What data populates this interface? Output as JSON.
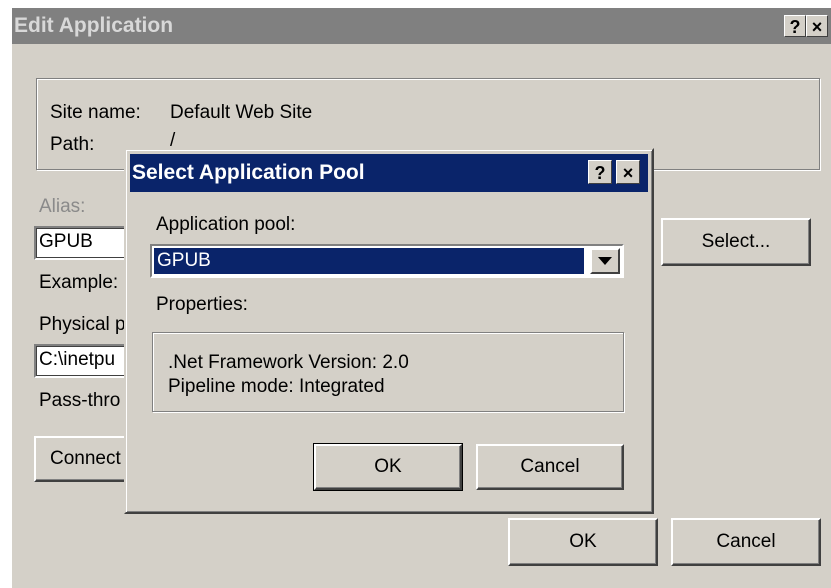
{
  "edit_app": {
    "title": "Edit Application",
    "help_icon": "?",
    "close_icon": "×",
    "site_name_label": "Site name:",
    "site_name_value": "Default Web Site",
    "path_label": "Path:",
    "path_value": "/",
    "alias_label": "Alias:",
    "alias_value": "GPUB",
    "example_label": "Example:",
    "physical_label": "Physical p",
    "physical_value": "C:\\inetpu",
    "passthrough_label": "Pass-thro",
    "connect_label": "Connect",
    "select_label": "Select...",
    "ok_label": "OK",
    "cancel_label": "Cancel"
  },
  "select_pool": {
    "title": "Select Application Pool",
    "help_icon": "?",
    "close_icon": "×",
    "pool_label": "Application pool:",
    "pool_value": "GPUB",
    "properties_label": "Properties:",
    "framework_line": ".Net Framework Version: 2.0",
    "pipeline_line": "Pipeline mode: Integrated",
    "ok_label": "OK",
    "cancel_label": "Cancel"
  },
  "icons": [
    "help-icon",
    "close-icon",
    "dropdown-arrow-icon"
  ],
  "colors": {
    "active_title": "#0a246a",
    "inactive_title": "#808080",
    "dialog_face": "#d4d0c8"
  }
}
